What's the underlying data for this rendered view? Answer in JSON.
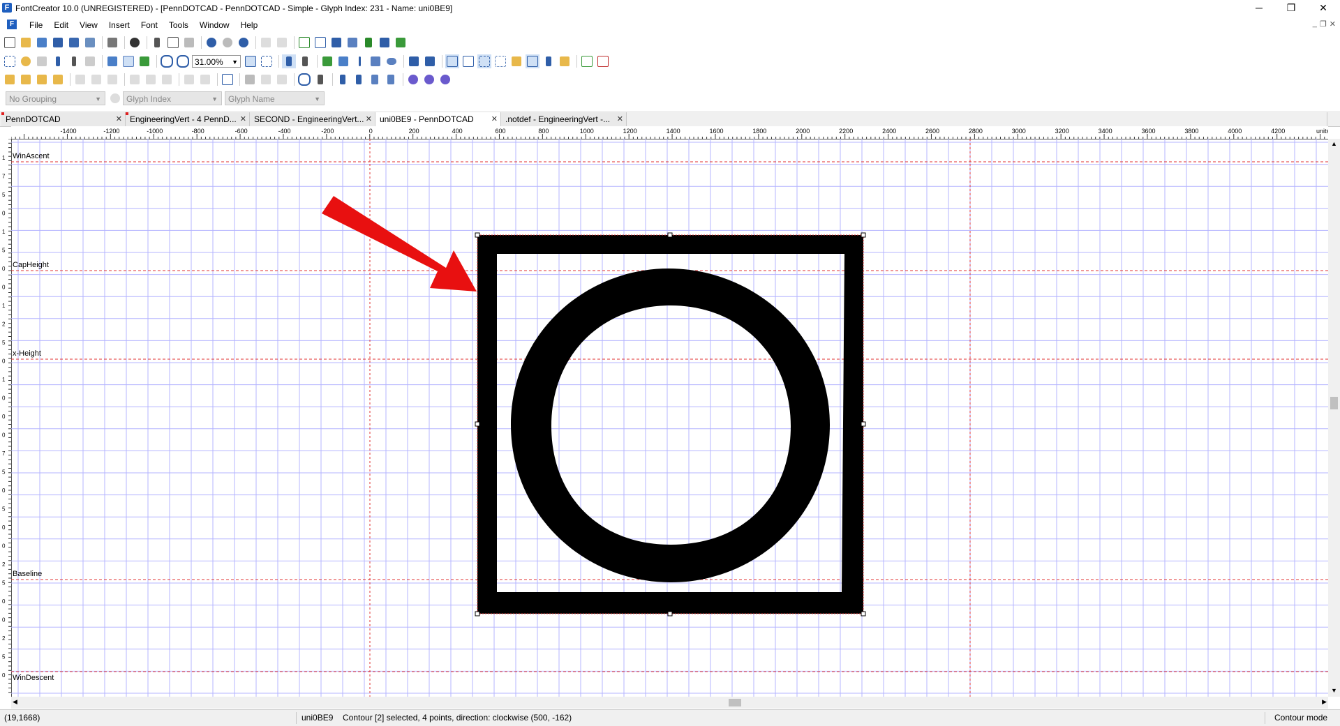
{
  "window": {
    "title": "FontCreator 10.0 (UNREGISTERED) - [PennDOTCAD - PennDOTCAD - Simple - Glyph Index: 231 - Name: uni0BE9]",
    "app_icon": "F",
    "minimize": "─",
    "maximize": "❐",
    "close": "✕"
  },
  "menu": {
    "icon": "F",
    "items": [
      "File",
      "Edit",
      "View",
      "Insert",
      "Font",
      "Tools",
      "Window",
      "Help"
    ],
    "mdi_minimize": "_",
    "mdi_restore": "❐",
    "mdi_close": "✕"
  },
  "toolbar": {
    "zoom_value": "31.00%",
    "zoom_arrow": "▼"
  },
  "filters": {
    "grouping": "No Grouping",
    "sort": "Glyph Index",
    "label": "Glyph Name",
    "arrow": "▼"
  },
  "tabs": [
    {
      "label": "PennDOTCAD",
      "close": "✕"
    },
    {
      "label": "EngineeringVert - 4 PennD...",
      "close": "✕"
    },
    {
      "label": "SECOND - EngineeringVert...",
      "close": "✕"
    },
    {
      "label": "uni0BE9 - PennDOTCAD",
      "close": "✕"
    },
    {
      "label": ".notdef - EngineeringVert -...",
      "close": "✕"
    }
  ],
  "ruler": {
    "labels": [
      "-1400",
      "-1200",
      "-1000",
      "-800",
      "-600",
      "-400",
      "-200",
      "0",
      "200",
      "400",
      "600",
      "800",
      "1000",
      "1200",
      "1400",
      "1600",
      "1800",
      "2000",
      "2200",
      "2400",
      "2600",
      "2800",
      "3000",
      "3200",
      "3400",
      "3600",
      "3800",
      "4000",
      "4200"
    ],
    "units": "units",
    "vertical_labels": [
      "1",
      "7",
      "5",
      "0",
      "1",
      "5",
      "0",
      "0",
      "1",
      "2",
      "5",
      "0",
      "1",
      "0",
      "0",
      "0",
      "7",
      "5",
      "0",
      "5",
      "0",
      "0",
      "2",
      "5",
      "0",
      "0",
      "2",
      "5",
      "0"
    ]
  },
  "metrics": {
    "win_ascent": "WinAscent",
    "cap_height": "CapHeight",
    "x_height": "x-Height",
    "baseline": "Baseline",
    "win_descent": "WinDescent"
  },
  "status": {
    "cursor": "(19,1668)",
    "glyph": "uni0BE9",
    "selection": "Contour [2] selected, 4 points, direction: clockwise (500, -162)",
    "mode": "Contour mode"
  },
  "colors": {
    "grid": "#b4b4ff",
    "guide": "#e03030",
    "arrow": "#e81010"
  }
}
